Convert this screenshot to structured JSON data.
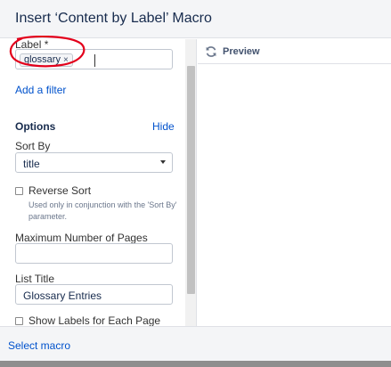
{
  "dialog": {
    "title": "Insert ‘Content by Label’ Macro"
  },
  "form": {
    "label_field": {
      "label": "Label *",
      "tags": [
        "glossary"
      ],
      "tag_remove": "×"
    },
    "add_filter": "Add a filter",
    "options": {
      "heading": "Options",
      "hide_link": "Hide"
    },
    "sort_by": {
      "label": "Sort By",
      "selected": "title"
    },
    "reverse_sort": {
      "label": "Reverse Sort",
      "checked": false,
      "help": "Used only in conjunction with the 'Sort By' parameter."
    },
    "max_pages": {
      "label": "Maximum Number of Pages",
      "value": ""
    },
    "list_title": {
      "label": "List Title",
      "value": "Glossary Entries"
    },
    "show_labels": {
      "label": "Show Labels for Each Page",
      "checked": false
    }
  },
  "preview": {
    "label": "Preview",
    "icon": "refresh-icon"
  },
  "footer": {
    "select_macro": "Select macro"
  },
  "colors": {
    "link": "#0052cc",
    "annotation": "#e3001b"
  }
}
